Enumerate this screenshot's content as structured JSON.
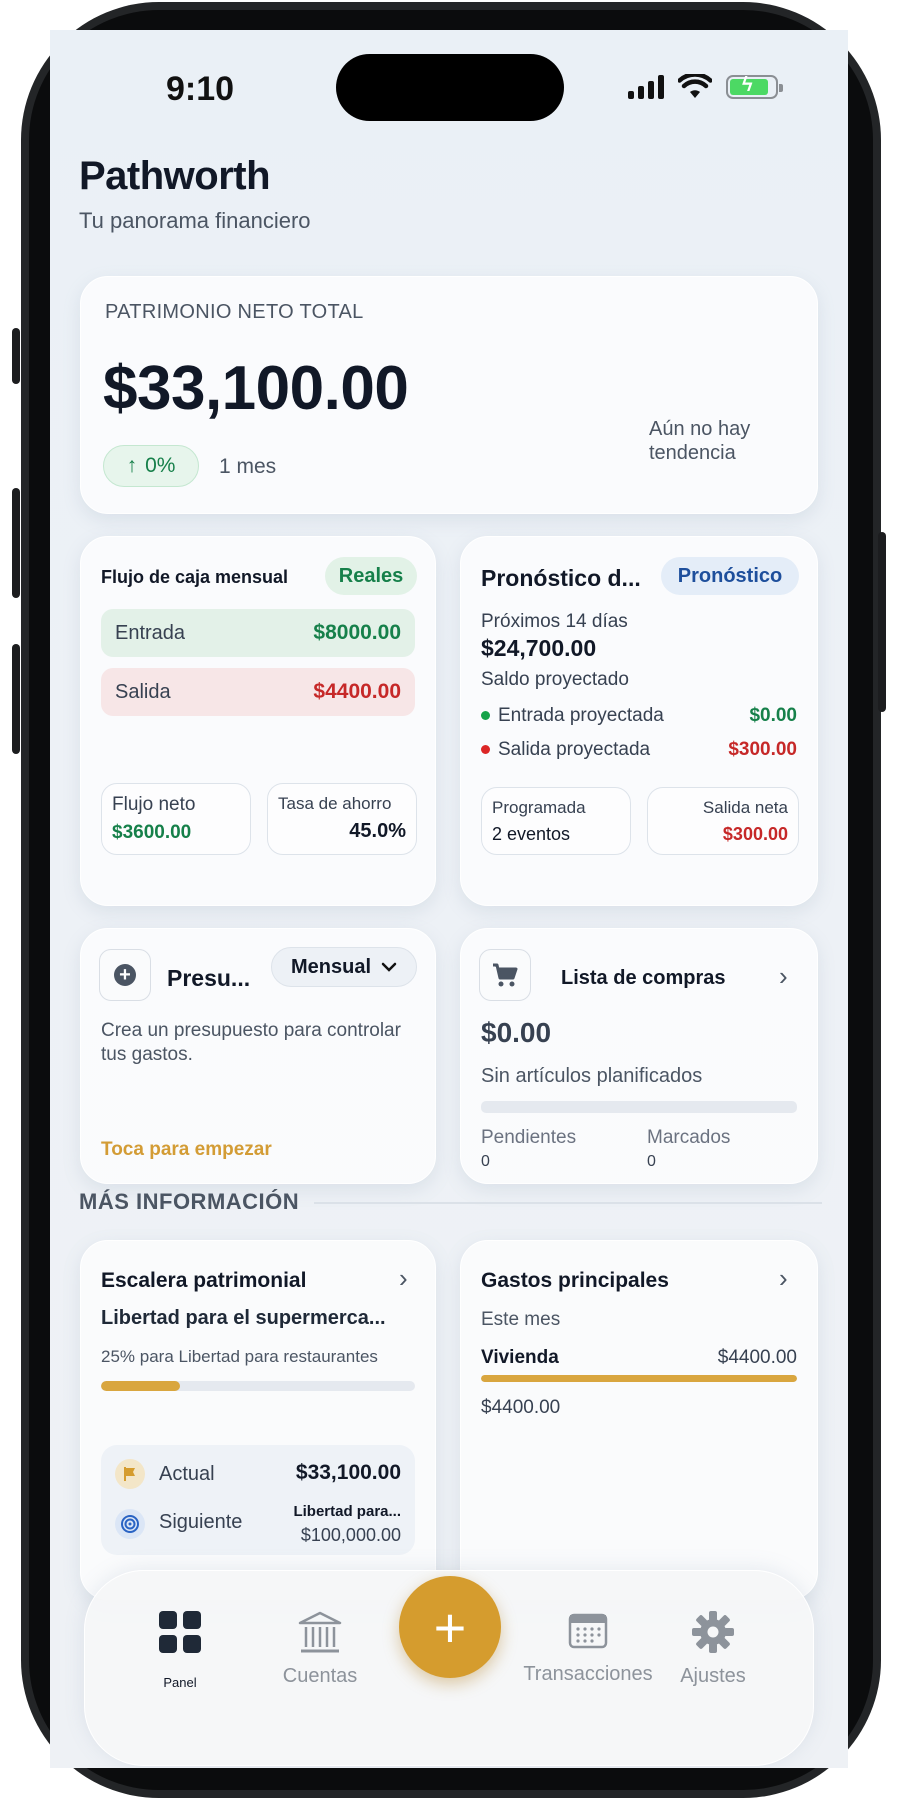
{
  "status_bar": {
    "time": "9:10"
  },
  "header": {
    "title": "Pathworth",
    "subtitle": "Tu panorama financiero"
  },
  "networth": {
    "label": "PATRIMONIO NETO TOTAL",
    "value": "$33,100.00",
    "change": "0%",
    "period": "1 mes",
    "trend_text": "Aún no hay tendencia"
  },
  "cashflow": {
    "title": "Flujo de caja mensual",
    "tag": "Reales",
    "in_label": "Entrada",
    "in_value": "$8000.00",
    "out_label": "Salida",
    "out_value": "$4400.00",
    "net_label": "Flujo neto",
    "net_value": "$3600.00",
    "savings_label": "Tasa de ahorro",
    "savings_value": "45.0%"
  },
  "forecast": {
    "title": "Pronóstico d...",
    "tag": "Pronóstico",
    "window": "Próximos 14 días",
    "balance": "$24,700.00",
    "balance_label": "Saldo proyectado",
    "in_label": "Entrada proyectada",
    "in_value": "$0.00",
    "out_label": "Salida proyectada",
    "out_value": "$300.00",
    "scheduled_label": "Programada",
    "scheduled_value": "2 eventos",
    "net_out_label": "Salida neta",
    "net_out_value": "$300.00"
  },
  "budget": {
    "title": "Presu...",
    "period_select": "Mensual",
    "description": "Crea un presupuesto para controlar tus gastos.",
    "cta": "Toca para empezar"
  },
  "shopping": {
    "title": "Lista de compras",
    "amount": "$0.00",
    "empty_text": "Sin artículos planificados",
    "progress": 0,
    "pending_label": "Pendientes",
    "pending_value": "0",
    "checked_label": "Marcados",
    "checked_value": "0"
  },
  "section": {
    "more_info": "MÁS INFORMACIÓN"
  },
  "ladder": {
    "title": "Escalera patrimonial",
    "goal": "Libertad para el supermerca...",
    "next_text": "25% para Libertad para restaurantes",
    "progress": 0.25,
    "current_label": "Actual",
    "current_value": "$33,100.00",
    "next_label": "Siguiente",
    "next_name": "Libertad para...",
    "next_value": "$100,000.00"
  },
  "top_expenses": {
    "title": "Gastos principales",
    "period": "Este mes",
    "items": [
      {
        "name": "Vivienda",
        "value": "$4400.00",
        "share": 1.0
      }
    ],
    "total": "$4400.00"
  },
  "tabbar": {
    "items": [
      {
        "label": "Panel",
        "icon": "grid-icon",
        "active": true
      },
      {
        "label": "Cuentas",
        "icon": "bank-icon"
      },
      {
        "label": "Transacciones",
        "icon": "calendar-icon"
      },
      {
        "label": "Ajustes",
        "icon": "gear-icon"
      }
    ],
    "add": "+"
  },
  "colors": {
    "accent": "#d59c2e",
    "positive": "#16804a",
    "negative": "#c62828",
    "forecast": "#1e4f9c"
  }
}
